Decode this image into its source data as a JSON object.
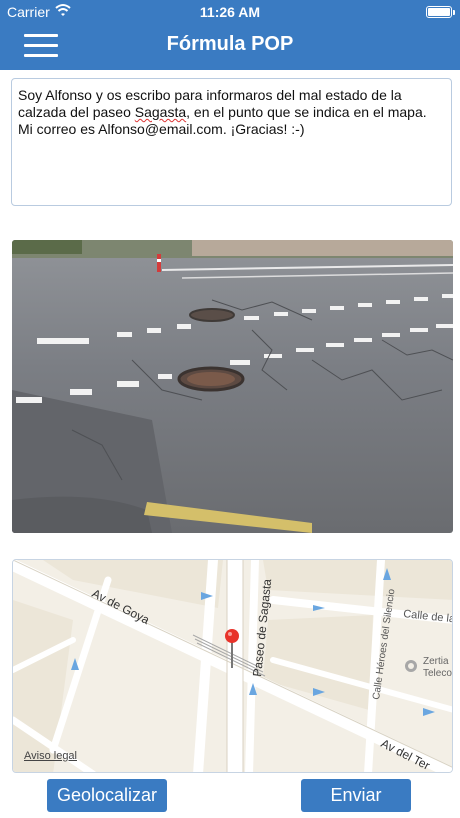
{
  "status_bar": {
    "carrier": "Carrier",
    "time": "11:26 AM",
    "wifi_icon": "wifi-icon",
    "battery_icon": "battery-icon",
    "battery_level": 1.0
  },
  "nav": {
    "title": "Fórmula POP",
    "menu_icon": "hamburger-menu-icon"
  },
  "message": {
    "part1": "Soy Alfonso y os escribo para informaros del mal estado de la calzada del paseo ",
    "misspelled": "Sagasta",
    "part2": ", en el punto que se indica en el mapa. Mi correo es Alfonso@email.com. ¡Gracias! :-)"
  },
  "photo": {
    "description_icon": "street-photo"
  },
  "map": {
    "streets": {
      "av_goya": "Av de Goya",
      "paseo_sagasta": "Paseo de Sagasta",
      "calle_la": "Calle de la",
      "calle_heroes": "Calle Héroes del Silencio",
      "av_del_ter": "Av del Ter"
    },
    "poi_1": "Zertia",
    "poi_2": "Teleco",
    "legal_link": "Aviso legal",
    "pin_icon": "map-pin-icon"
  },
  "buttons": {
    "geolocate": "Geolocalizar",
    "send": "Enviar"
  },
  "colors": {
    "primary": "#3a7bc2",
    "pin": "#e8332a"
  }
}
